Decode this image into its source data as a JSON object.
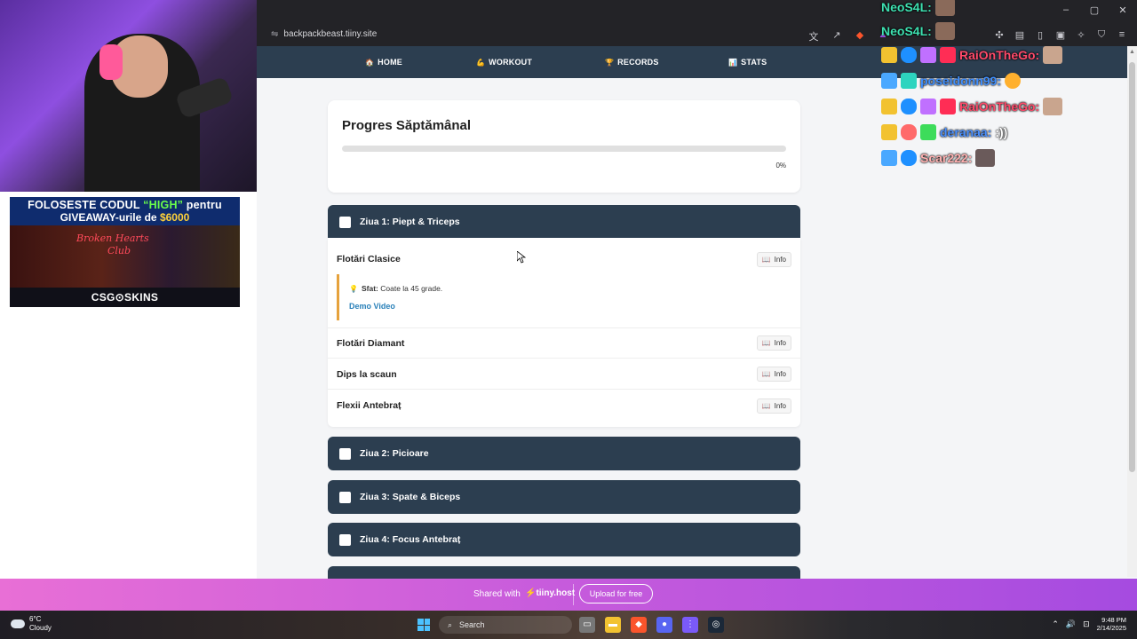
{
  "browser": {
    "url": "backpackbeast.tiiny.site"
  },
  "nav": {
    "items": [
      {
        "icon": "🏠",
        "label": "HOME"
      },
      {
        "icon": "💪",
        "label": "WORKOUT"
      },
      {
        "icon": "🏆",
        "label": "RECORDS"
      },
      {
        "icon": "📊",
        "label": "STATS"
      }
    ]
  },
  "progress": {
    "title": "Progres Săptămânal",
    "percent_label": "0%",
    "fill_fraction": 0
  },
  "days": [
    {
      "label": "Ziua 1: Piept & Triceps",
      "expanded": true
    },
    {
      "label": "Ziua 2: Picioare",
      "expanded": false
    },
    {
      "label": "Ziua 3: Spate & Biceps",
      "expanded": false
    },
    {
      "label": "Ziua 4: Focus Antebraț",
      "expanded": false
    }
  ],
  "exercises": [
    {
      "name": "Flotări Clasice",
      "info": "Info"
    },
    {
      "name": "Flotări Diamant",
      "info": "Info"
    },
    {
      "name": "Dips la scaun",
      "info": "Info"
    },
    {
      "name": "Flexii Antebraț",
      "info": "Info"
    }
  ],
  "tip": {
    "label": "Sfat:",
    "text": "Coate la 45 grade.",
    "demo": "Demo Video"
  },
  "banner": {
    "shared": "Shared with",
    "brand": "⚡tiiny.host",
    "upload": "Upload for free"
  },
  "taskbar": {
    "temp": "6°C",
    "weather": "Cloudy",
    "search": "Search",
    "time": "9:48 PM",
    "date": "2/14/2025"
  },
  "ad": {
    "line1_pre": "FOLOSESTE CODUL ",
    "line1_code": "“HIGH”",
    "line1_post": " pentru",
    "line2_pre": "GIVEAWAY-urile de ",
    "line2_amount": "$6000",
    "sign1": "Broken Hearts",
    "sign2": "Club",
    "footer": "CSG⊙SKINS"
  },
  "chat": [
    {
      "user": "NeoS4L:",
      "message": "",
      "color": "#3de0b0"
    },
    {
      "user": "NeoS4L:",
      "message": "",
      "color": "#3de0b0"
    },
    {
      "user": "RaiOnTheGo:",
      "message": "",
      "color": "#ff4a6a"
    },
    {
      "user": "poseidonn99:",
      "message": "",
      "color": "#3f8fff"
    },
    {
      "user": "RaiOnTheGo:",
      "message": "",
      "color": "#ff4a6a"
    },
    {
      "user": "deranaa:",
      "message": ":))",
      "color": "#4a90ff"
    },
    {
      "user": "Scar222:",
      "message": "",
      "color": "#ffb0b0"
    }
  ],
  "colors": {
    "nav_bg": "#2c3e50",
    "banner_start": "#e86fd6",
    "banner_end": "#a54be0",
    "tip_border": "#e6a23c",
    "link": "#2980b9"
  }
}
